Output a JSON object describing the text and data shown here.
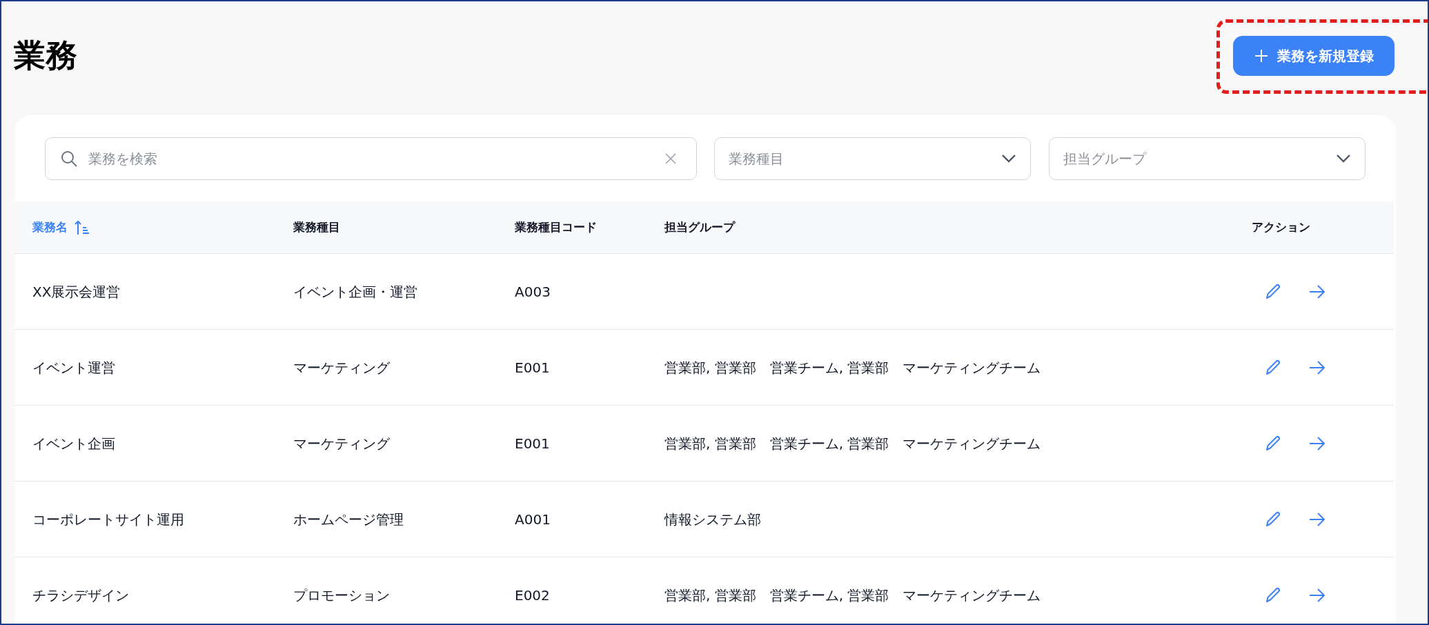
{
  "page": {
    "title": "業務"
  },
  "new_button": {
    "label": "業務を新規登録",
    "highlighted": true
  },
  "search": {
    "placeholder": "業務を検索"
  },
  "filters": [
    {
      "placeholder": "業務種目"
    },
    {
      "placeholder": "担当グループ"
    }
  ],
  "table": {
    "columns": [
      {
        "label": "業務名",
        "sorted": true
      },
      {
        "label": "業務種目",
        "sorted": false
      },
      {
        "label": "業務種目コード",
        "sorted": false
      },
      {
        "label": "担当グループ",
        "sorted": false
      },
      {
        "label": "アクション",
        "sorted": false
      }
    ],
    "rows": [
      {
        "name": "XX展示会運営",
        "category": "イベント企画・運営",
        "code": "A003",
        "groups": ""
      },
      {
        "name": "イベント運営",
        "category": "マーケティング",
        "code": "E001",
        "groups": "営業部, 営業部　営業チーム, 営業部　マーケティングチーム"
      },
      {
        "name": "イベント企画",
        "category": "マーケティング",
        "code": "E001",
        "groups": "営業部, 営業部　営業チーム, 営業部　マーケティングチーム"
      },
      {
        "name": "コーポレートサイト運用",
        "category": "ホームページ管理",
        "code": "A001",
        "groups": "情報システム部"
      },
      {
        "name": "チラシデザイン",
        "category": "プロモーション",
        "code": "E002",
        "groups": "営業部, 営業部　営業チーム, 営業部　マーケティングチーム"
      }
    ]
  }
}
